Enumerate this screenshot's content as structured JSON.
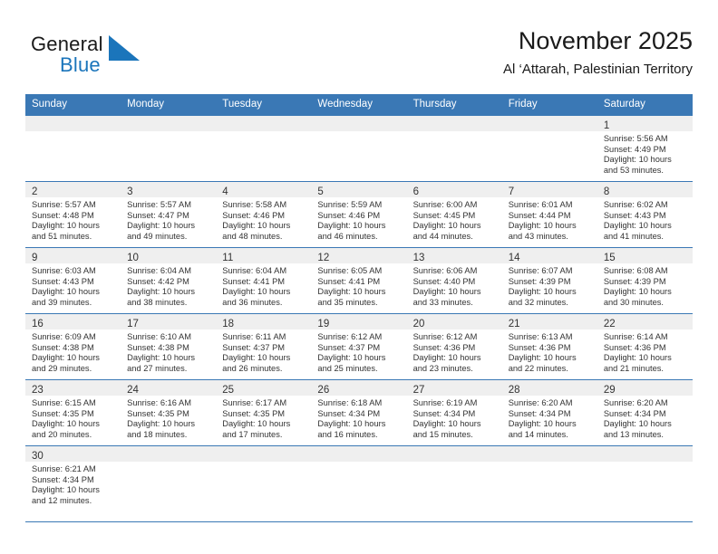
{
  "brand": {
    "name_part1": "General",
    "name_part2": "Blue",
    "mark_icon": "blue-triangle-icon"
  },
  "header": {
    "title": "November 2025",
    "subtitle": "Al ‘Attarah, Palestinian Territory"
  },
  "calendar": {
    "weekday_headers": [
      "Sunday",
      "Monday",
      "Tuesday",
      "Wednesday",
      "Thursday",
      "Friday",
      "Saturday"
    ],
    "accent_color": "#3a78b5",
    "daynum_band_color": "#efefef",
    "weeks": [
      [
        {
          "empty": true
        },
        {
          "empty": true
        },
        {
          "empty": true
        },
        {
          "empty": true
        },
        {
          "empty": true
        },
        {
          "empty": true
        },
        {
          "empty": false,
          "day": "1",
          "sunrise": "Sunrise: 5:56 AM",
          "sunset": "Sunset: 4:49 PM",
          "daylight1": "Daylight: 10 hours",
          "daylight2": "and 53 minutes."
        }
      ],
      [
        {
          "empty": false,
          "day": "2",
          "sunrise": "Sunrise: 5:57 AM",
          "sunset": "Sunset: 4:48 PM",
          "daylight1": "Daylight: 10 hours",
          "daylight2": "and 51 minutes."
        },
        {
          "empty": false,
          "day": "3",
          "sunrise": "Sunrise: 5:57 AM",
          "sunset": "Sunset: 4:47 PM",
          "daylight1": "Daylight: 10 hours",
          "daylight2": "and 49 minutes."
        },
        {
          "empty": false,
          "day": "4",
          "sunrise": "Sunrise: 5:58 AM",
          "sunset": "Sunset: 4:46 PM",
          "daylight1": "Daylight: 10 hours",
          "daylight2": "and 48 minutes."
        },
        {
          "empty": false,
          "day": "5",
          "sunrise": "Sunrise: 5:59 AM",
          "sunset": "Sunset: 4:46 PM",
          "daylight1": "Daylight: 10 hours",
          "daylight2": "and 46 minutes."
        },
        {
          "empty": false,
          "day": "6",
          "sunrise": "Sunrise: 6:00 AM",
          "sunset": "Sunset: 4:45 PM",
          "daylight1": "Daylight: 10 hours",
          "daylight2": "and 44 minutes."
        },
        {
          "empty": false,
          "day": "7",
          "sunrise": "Sunrise: 6:01 AM",
          "sunset": "Sunset: 4:44 PM",
          "daylight1": "Daylight: 10 hours",
          "daylight2": "and 43 minutes."
        },
        {
          "empty": false,
          "day": "8",
          "sunrise": "Sunrise: 6:02 AM",
          "sunset": "Sunset: 4:43 PM",
          "daylight1": "Daylight: 10 hours",
          "daylight2": "and 41 minutes."
        }
      ],
      [
        {
          "empty": false,
          "day": "9",
          "sunrise": "Sunrise: 6:03 AM",
          "sunset": "Sunset: 4:43 PM",
          "daylight1": "Daylight: 10 hours",
          "daylight2": "and 39 minutes."
        },
        {
          "empty": false,
          "day": "10",
          "sunrise": "Sunrise: 6:04 AM",
          "sunset": "Sunset: 4:42 PM",
          "daylight1": "Daylight: 10 hours",
          "daylight2": "and 38 minutes."
        },
        {
          "empty": false,
          "day": "11",
          "sunrise": "Sunrise: 6:04 AM",
          "sunset": "Sunset: 4:41 PM",
          "daylight1": "Daylight: 10 hours",
          "daylight2": "and 36 minutes."
        },
        {
          "empty": false,
          "day": "12",
          "sunrise": "Sunrise: 6:05 AM",
          "sunset": "Sunset: 4:41 PM",
          "daylight1": "Daylight: 10 hours",
          "daylight2": "and 35 minutes."
        },
        {
          "empty": false,
          "day": "13",
          "sunrise": "Sunrise: 6:06 AM",
          "sunset": "Sunset: 4:40 PM",
          "daylight1": "Daylight: 10 hours",
          "daylight2": "and 33 minutes."
        },
        {
          "empty": false,
          "day": "14",
          "sunrise": "Sunrise: 6:07 AM",
          "sunset": "Sunset: 4:39 PM",
          "daylight1": "Daylight: 10 hours",
          "daylight2": "and 32 minutes."
        },
        {
          "empty": false,
          "day": "15",
          "sunrise": "Sunrise: 6:08 AM",
          "sunset": "Sunset: 4:39 PM",
          "daylight1": "Daylight: 10 hours",
          "daylight2": "and 30 minutes."
        }
      ],
      [
        {
          "empty": false,
          "day": "16",
          "sunrise": "Sunrise: 6:09 AM",
          "sunset": "Sunset: 4:38 PM",
          "daylight1": "Daylight: 10 hours",
          "daylight2": "and 29 minutes."
        },
        {
          "empty": false,
          "day": "17",
          "sunrise": "Sunrise: 6:10 AM",
          "sunset": "Sunset: 4:38 PM",
          "daylight1": "Daylight: 10 hours",
          "daylight2": "and 27 minutes."
        },
        {
          "empty": false,
          "day": "18",
          "sunrise": "Sunrise: 6:11 AM",
          "sunset": "Sunset: 4:37 PM",
          "daylight1": "Daylight: 10 hours",
          "daylight2": "and 26 minutes."
        },
        {
          "empty": false,
          "day": "19",
          "sunrise": "Sunrise: 6:12 AM",
          "sunset": "Sunset: 4:37 PM",
          "daylight1": "Daylight: 10 hours",
          "daylight2": "and 25 minutes."
        },
        {
          "empty": false,
          "day": "20",
          "sunrise": "Sunrise: 6:12 AM",
          "sunset": "Sunset: 4:36 PM",
          "daylight1": "Daylight: 10 hours",
          "daylight2": "and 23 minutes."
        },
        {
          "empty": false,
          "day": "21",
          "sunrise": "Sunrise: 6:13 AM",
          "sunset": "Sunset: 4:36 PM",
          "daylight1": "Daylight: 10 hours",
          "daylight2": "and 22 minutes."
        },
        {
          "empty": false,
          "day": "22",
          "sunrise": "Sunrise: 6:14 AM",
          "sunset": "Sunset: 4:36 PM",
          "daylight1": "Daylight: 10 hours",
          "daylight2": "and 21 minutes."
        }
      ],
      [
        {
          "empty": false,
          "day": "23",
          "sunrise": "Sunrise: 6:15 AM",
          "sunset": "Sunset: 4:35 PM",
          "daylight1": "Daylight: 10 hours",
          "daylight2": "and 20 minutes."
        },
        {
          "empty": false,
          "day": "24",
          "sunrise": "Sunrise: 6:16 AM",
          "sunset": "Sunset: 4:35 PM",
          "daylight1": "Daylight: 10 hours",
          "daylight2": "and 18 minutes."
        },
        {
          "empty": false,
          "day": "25",
          "sunrise": "Sunrise: 6:17 AM",
          "sunset": "Sunset: 4:35 PM",
          "daylight1": "Daylight: 10 hours",
          "daylight2": "and 17 minutes."
        },
        {
          "empty": false,
          "day": "26",
          "sunrise": "Sunrise: 6:18 AM",
          "sunset": "Sunset: 4:34 PM",
          "daylight1": "Daylight: 10 hours",
          "daylight2": "and 16 minutes."
        },
        {
          "empty": false,
          "day": "27",
          "sunrise": "Sunrise: 6:19 AM",
          "sunset": "Sunset: 4:34 PM",
          "daylight1": "Daylight: 10 hours",
          "daylight2": "and 15 minutes."
        },
        {
          "empty": false,
          "day": "28",
          "sunrise": "Sunrise: 6:20 AM",
          "sunset": "Sunset: 4:34 PM",
          "daylight1": "Daylight: 10 hours",
          "daylight2": "and 14 minutes."
        },
        {
          "empty": false,
          "day": "29",
          "sunrise": "Sunrise: 6:20 AM",
          "sunset": "Sunset: 4:34 PM",
          "daylight1": "Daylight: 10 hours",
          "daylight2": "and 13 minutes."
        }
      ],
      [
        {
          "empty": false,
          "day": "30",
          "sunrise": "Sunrise: 6:21 AM",
          "sunset": "Sunset: 4:34 PM",
          "daylight1": "Daylight: 10 hours",
          "daylight2": "and 12 minutes."
        },
        {
          "empty": true
        },
        {
          "empty": true
        },
        {
          "empty": true
        },
        {
          "empty": true
        },
        {
          "empty": true
        },
        {
          "empty": true
        }
      ]
    ]
  }
}
